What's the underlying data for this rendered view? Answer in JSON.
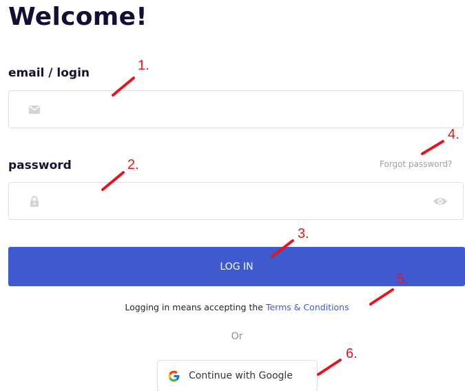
{
  "title": "Welcome!",
  "email": {
    "label": "email / login",
    "value": "",
    "icon": "envelope-icon"
  },
  "password": {
    "label": "password",
    "value": "",
    "icon": "lock-icon",
    "toggle_icon": "eye-icon",
    "forgot_label": "Forgot password?"
  },
  "login_button": {
    "label": "LOG IN"
  },
  "terms": {
    "prefix": "Logging in means accepting the ",
    "link": "Terms & Conditions"
  },
  "divider": {
    "label": "Or"
  },
  "google_button": {
    "label": "Continue with Google",
    "icon": "google-icon"
  },
  "annotations": {
    "labels": [
      "1.",
      "2.",
      "3.",
      "4.",
      "5.",
      "6."
    ],
    "color": "#e8141b"
  },
  "colors": {
    "primary": "#3f5acf",
    "title": "#0f1033",
    "muted": "#9aa1ad"
  }
}
